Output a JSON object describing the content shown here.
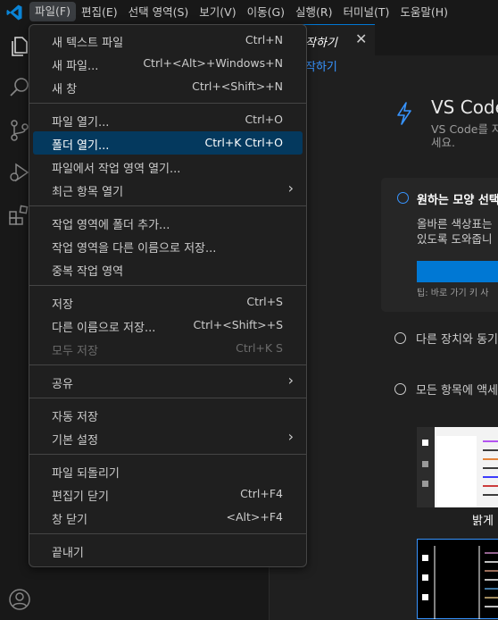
{
  "menubar": {
    "items": [
      {
        "label": "파일(F)"
      },
      {
        "label": "편집(E)"
      },
      {
        "label": "선택 영역(S)"
      },
      {
        "label": "보기(V)"
      },
      {
        "label": "이동(G)"
      },
      {
        "label": "실행(R)"
      },
      {
        "label": "터미널(T)"
      },
      {
        "label": "도움말(H)"
      }
    ]
  },
  "activity_icons": [
    "explorer-icon",
    "search-icon",
    "source-control-icon",
    "run-debug-icon",
    "extensions-icon",
    "account-icon"
  ],
  "tab": {
    "label": "작하기",
    "close": "✕"
  },
  "breadcrumb": "작하기",
  "walkthrough": {
    "title": "VS Code",
    "subtitle": "VS Code를 자 세요.",
    "steps": [
      {
        "title": "원하는 모양 선택",
        "desc_line1": "올바른 색상표는",
        "desc_line2": "있도록 도와줍니",
        "tip": "팁: 바로 가기 키 사"
      },
      {
        "title": "다른 장치와 동기"
      },
      {
        "title": "모든 항목에 액세"
      }
    ],
    "theme_label": "밝게"
  },
  "file_menu": {
    "items": [
      {
        "label": "새 텍스트 파일",
        "shortcut": "Ctrl+N"
      },
      {
        "label": "새 파일...",
        "shortcut": "Ctrl+<Alt>+Windows+N"
      },
      {
        "label": "새 창",
        "shortcut": "Ctrl+<Shift>+N"
      },
      {
        "label": "파일 열기...",
        "shortcut": "Ctrl+O"
      },
      {
        "label": "폴더 열기...",
        "shortcut": "Ctrl+K Ctrl+O"
      },
      {
        "label": "파일에서 작업 영역 열기...",
        "shortcut": ""
      },
      {
        "label": "최근 항목 열기",
        "shortcut": ""
      },
      {
        "label": "작업 영역에 폴더 추가...",
        "shortcut": ""
      },
      {
        "label": "작업 영역을 다른 이름으로 저장...",
        "shortcut": ""
      },
      {
        "label": "중복 작업 영역",
        "shortcut": ""
      },
      {
        "label": "저장",
        "shortcut": "Ctrl+S"
      },
      {
        "label": "다른 이름으로 저장...",
        "shortcut": "Ctrl+<Shift>+S"
      },
      {
        "label": "모두 저장",
        "shortcut": "Ctrl+K S"
      },
      {
        "label": "공유",
        "shortcut": ""
      },
      {
        "label": "자동 저장",
        "shortcut": ""
      },
      {
        "label": "기본 설정",
        "shortcut": ""
      },
      {
        "label": "파일 되돌리기",
        "shortcut": ""
      },
      {
        "label": "편집기 닫기",
        "shortcut": "Ctrl+F4"
      },
      {
        "label": "창 닫기",
        "shortcut": "<Alt>+F4"
      },
      {
        "label": "끝내기",
        "shortcut": ""
      }
    ],
    "submenu_chevron": "›"
  },
  "colors": {
    "accent": "#0078d4",
    "highlight": "#04395e",
    "link": "#3794ff"
  }
}
